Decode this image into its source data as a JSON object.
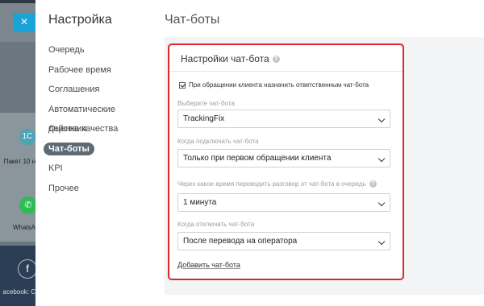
{
  "background_app": {
    "close_icon": "×",
    "item1_badge": "1С",
    "item1_label": "Пакет 10 н",
    "item2_label": "WhatsA",
    "item3_label": "acebook: C"
  },
  "panel": {
    "title": "Настройка",
    "nav": [
      {
        "label": "Очередь"
      },
      {
        "label": "Рабочее время"
      },
      {
        "label": "Соглашения"
      },
      {
        "label": "Автоматические действия"
      },
      {
        "label": "Оценка качества"
      },
      {
        "label": "Чат-боты",
        "active": true
      },
      {
        "label": "KPI"
      },
      {
        "label": "Прочее"
      }
    ]
  },
  "main": {
    "section_title": "Чат-боты",
    "card": {
      "title": "Настройки чат-бота",
      "checkbox_label": "При обращении клиента назначить ответственным чат-бота",
      "checkbox_checked": true,
      "fields": [
        {
          "label": "Выберите чат-бота",
          "value": "TrackingFix"
        },
        {
          "label": "Когда подключать чат-бота",
          "value": "Только при первом обращении клиента"
        },
        {
          "label": "Через какое время переводить разговор от чат-бота в очередь",
          "value": "1 минута"
        },
        {
          "label": "Когда отключать чат-бота",
          "value": "После перевода на оператора"
        }
      ],
      "add_link": "Добавить чат-бота"
    }
  },
  "colors": {
    "highlight_border": "#e0242b",
    "active_nav_bg": "#5e6b75",
    "close_button": "#1aa3d6"
  }
}
